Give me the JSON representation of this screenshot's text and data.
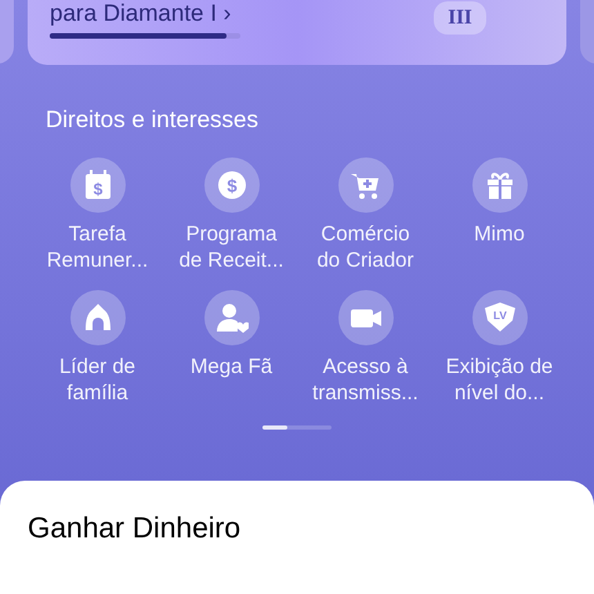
{
  "level_card": {
    "text": "para Diamante I ›",
    "level": 0.93,
    "badge": "III"
  },
  "section_title": "Direitos e interesses",
  "benefits": [
    {
      "label": "Tarefa\nRemuner...",
      "icon_text": "$"
    },
    {
      "label": "Programa\nde Receit...",
      "icon_text": "$"
    },
    {
      "label": "Comércio\ndo Criador"
    },
    {
      "label": "Mimo"
    },
    {
      "label": "Líder de\nfamília"
    },
    {
      "label": "Mega Fã"
    },
    {
      "label": "Acesso à\ntransmiss..."
    },
    {
      "label": "Exibição de\nnível do...",
      "icon_text": "LV"
    }
  ],
  "pager": {
    "level": 0.35
  },
  "sheet": {
    "title": "Ganhar Dinheiro"
  }
}
